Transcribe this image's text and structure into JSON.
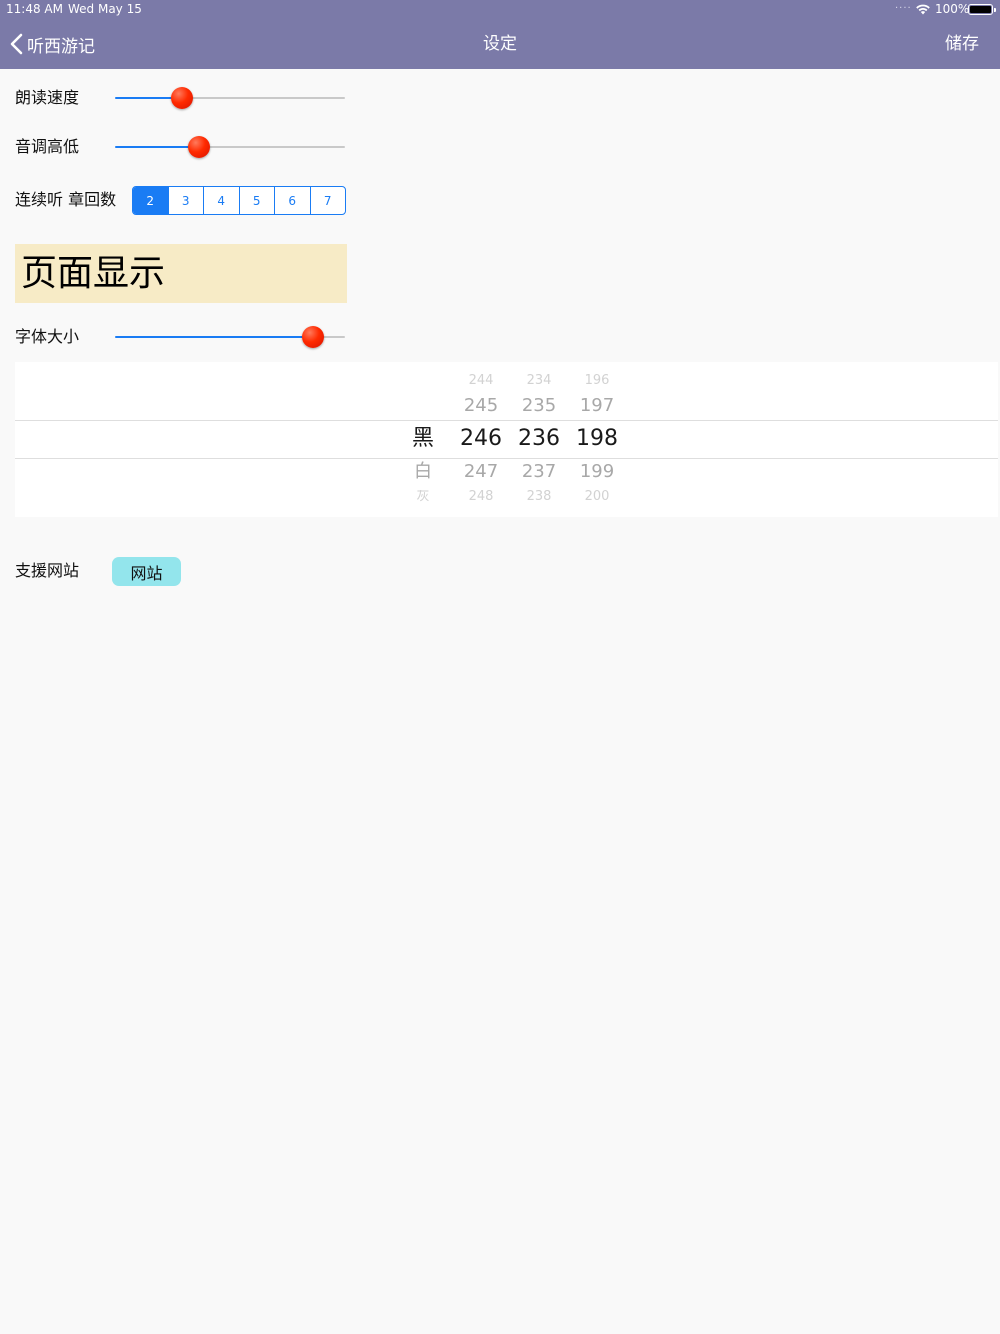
{
  "status_bar": {
    "time": "11:48 AM",
    "date": "Wed May 15",
    "battery": "100%"
  },
  "nav": {
    "back_label": "听西游记",
    "title": "设定",
    "save_label": "储存",
    "bar_color": "#7b7aa8"
  },
  "settings": {
    "reading_speed": {
      "label": "朗读速度",
      "value": 0.27
    },
    "pitch": {
      "label": "音调高低",
      "value": 0.35
    },
    "chapters": {
      "label": "连续听 章回数",
      "options": [
        "2",
        "3",
        "4",
        "5",
        "6",
        "7"
      ],
      "selected": "2"
    }
  },
  "display": {
    "heading": "页面显示",
    "font_size": {
      "label": "字体大小",
      "value": 0.9
    },
    "color_picker": {
      "name_column": [
        "",
        "",
        "黑",
        "白",
        "灰"
      ],
      "r_column": [
        "244",
        "245",
        "246",
        "247",
        "248"
      ],
      "g_column": [
        "234",
        "235",
        "236",
        "237",
        "238"
      ],
      "b_column": [
        "196",
        "197",
        "198",
        "199",
        "200"
      ],
      "selected_index": 2
    }
  },
  "support": {
    "label": "支援网站",
    "button_label": "网站"
  },
  "colors": {
    "accent": "#1a7cf4",
    "slider_thumb": "#ff2a00",
    "preview_background": "#f7ebc6",
    "website_button": "#93e5ec"
  }
}
